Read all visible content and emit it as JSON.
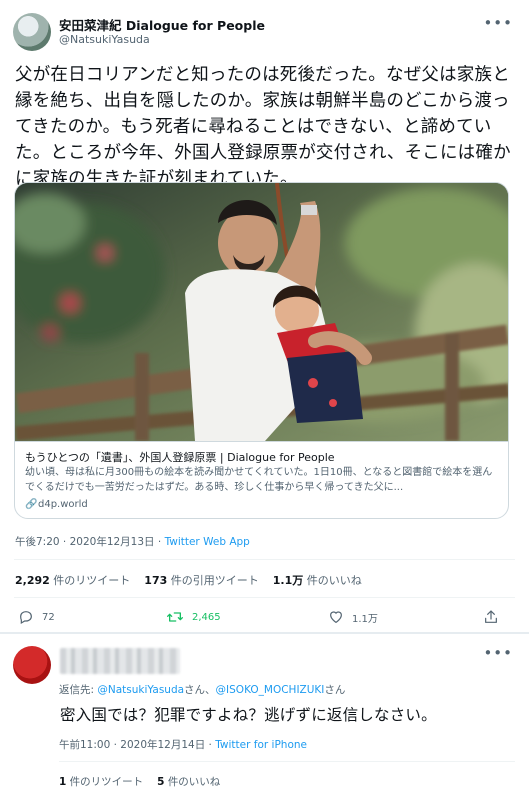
{
  "tweet1": {
    "author_name": "安田菜津紀 Dialogue for People",
    "author_handle": "@NatsukiYasuda",
    "more_icon": "more-dots-icon",
    "text": "父が在日コリアンだと知ったのは死後だった。なぜ父は家族と縁を絶ち、出自を隠したのか。家族は朝鮮半島のどこから渡ってきたのか。もう死者に尋ねることはできない、と諦めていた。ところが今年、外国人登録原票が交付され、そこには確かに家族の生きた証が刻まれていた。",
    "card": {
      "title": "もうひとつの「遺書」、外国人登録原票 | Dialogue for People",
      "description": "幼い頃、母は私に月300冊もの絵本を読み聞かせてくれていた。1日10冊、となると図書館で絵本を選んでくるだけでも一苦労だったはずだ。ある時、珍しく仕事から早く帰ってきた父に...",
      "domain": "d4p.world"
    },
    "time": "午後7:20 · 2020年12月13日",
    "client": "Twitter Web App",
    "stats": {
      "retweets_value": "2,292",
      "retweets_label": "件のリツイート",
      "quotes_value": "173",
      "quotes_label": "件の引用ツイート",
      "likes_value": "1.1万",
      "likes_label": "件のいいね"
    },
    "actions": {
      "reply_count": "72",
      "retweet_count": "2,465",
      "like_count": "1.1万",
      "reply_icon": "reply-icon",
      "retweet_icon": "retweet-icon",
      "like_icon": "heart-icon",
      "share_icon": "share-icon"
    }
  },
  "tweet2": {
    "reply_prefix": "返信先: ",
    "mention1": "@NatsukiYasuda",
    "suffix1": "さん、",
    "mention2": "@ISOKO_MOCHIZUKI",
    "suffix2": "さん",
    "text": "密入国では？犯罪ですよね？逃げずに返信しなさい。",
    "time": "午前11:00 · 2020年12月14日",
    "client": "Twitter for iPhone",
    "stats": {
      "retweets_value": "1",
      "retweets_label": "件のリツイート",
      "likes_value": "5",
      "likes_label": "件のいいね"
    }
  },
  "colors": {
    "accent": "#1d9bf0",
    "retweet_green": "#17bf63",
    "secondary_text": "#536471"
  }
}
